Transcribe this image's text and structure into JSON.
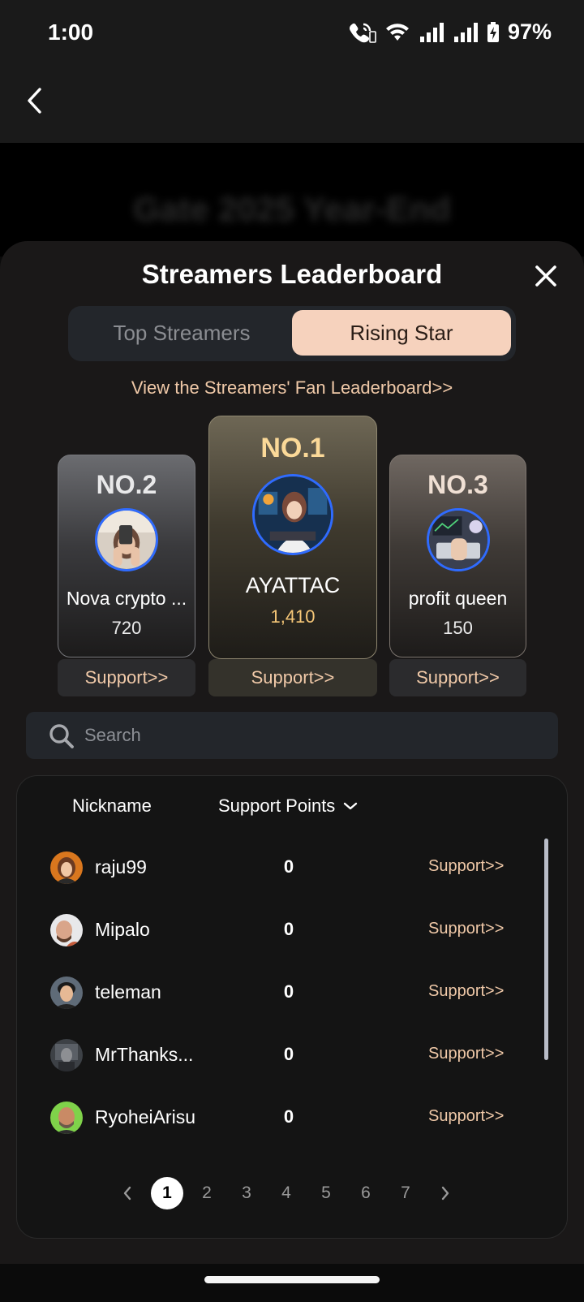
{
  "status_bar": {
    "time": "1:00",
    "battery": "97%"
  },
  "background_banner": "Gate 2025 Year-End",
  "sheet": {
    "title": "Streamers Leaderboard",
    "tabs": [
      {
        "label": "Top Streamers",
        "active": false
      },
      {
        "label": "Rising Star",
        "active": true
      }
    ],
    "fan_link": "View the Streamers' Fan Leaderboard>>"
  },
  "podium": {
    "first": {
      "rank": "NO.1",
      "name": "AYATTAC",
      "score": "1,410",
      "support": "Support>>"
    },
    "second": {
      "rank": "NO.2",
      "name": "Nova crypto ...",
      "score": "720",
      "support": "Support>>"
    },
    "third": {
      "rank": "NO.3",
      "name": "profit queen",
      "score": "150",
      "support": "Support>>"
    }
  },
  "search": {
    "placeholder": "Search"
  },
  "table": {
    "col_nickname": "Nickname",
    "col_points": "Support Points",
    "rows": [
      {
        "name": "raju99",
        "points": "0",
        "support": "Support>>"
      },
      {
        "name": "Mipalo",
        "points": "0",
        "support": "Support>>"
      },
      {
        "name": "teleman",
        "points": "0",
        "support": "Support>>"
      },
      {
        "name": "MrThanks...",
        "points": "0",
        "support": "Support>>"
      },
      {
        "name": "RyoheiArisu",
        "points": "0",
        "support": "Support>>"
      }
    ]
  },
  "pagination": {
    "pages": [
      "1",
      "2",
      "3",
      "4",
      "5",
      "6",
      "7"
    ],
    "current": "1"
  },
  "colors": {
    "accent": "#f6d2bd",
    "link": "#f0c9a8",
    "gold": "#fbd998",
    "ring": "#2f6bff"
  }
}
